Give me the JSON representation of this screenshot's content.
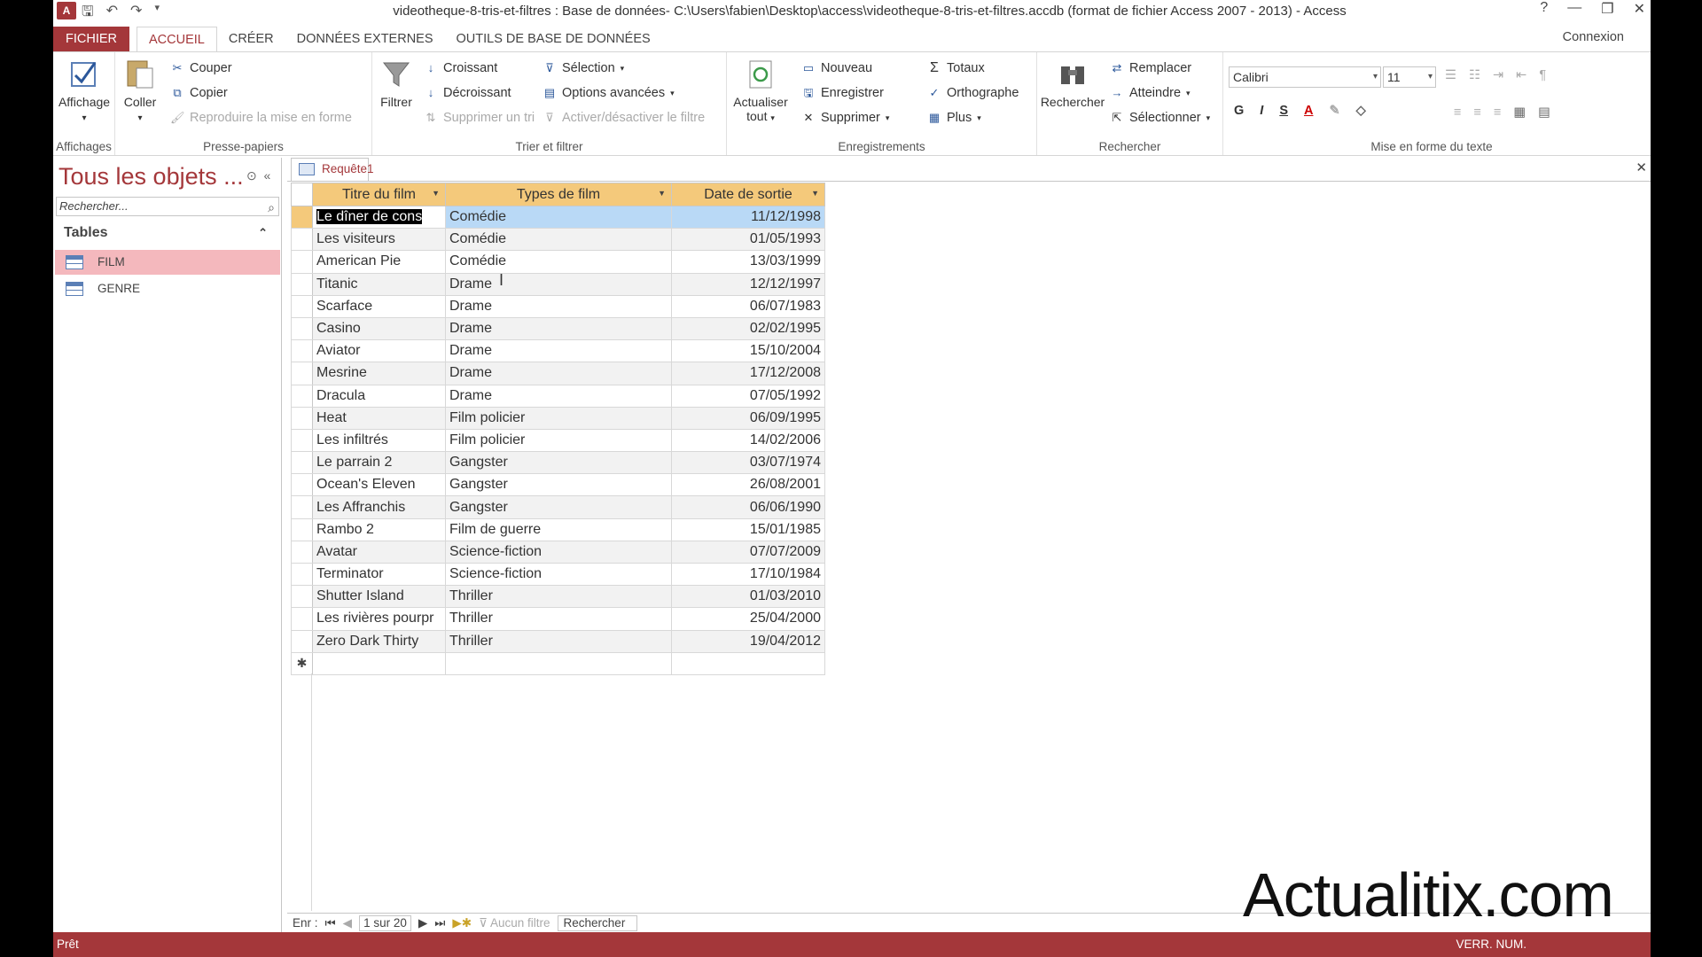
{
  "window": {
    "title": "videotheque-8-tris-et-filtres : Base de données- C:\\Users\\fabien\\Desktop\\access\\videotheque-8-tris-et-filtres.accdb (format de fichier Access 2007 - 2013) - Access",
    "help": "?",
    "minimize": "—",
    "restore": "❐",
    "close": "✕",
    "app_icon": "A"
  },
  "tabs": [
    "FICHIER",
    "ACCUEIL",
    "CRÉER",
    "DONNÉES EXTERNES",
    "OUTILS DE BASE DE DONNÉES"
  ],
  "account": "Connexion",
  "ribbon": {
    "affichages": {
      "view": "Affichage",
      "label": "Affichages"
    },
    "presse": {
      "paste": "Coller",
      "cut": "Couper",
      "copy": "Copier",
      "format_painter": "Reproduire la mise en forme",
      "label": "Presse-papiers"
    },
    "trier": {
      "filter": "Filtrer",
      "asc": "Croissant",
      "desc": "Décroissant",
      "remove_sort": "Supprimer un tri",
      "selection": "Sélection",
      "advanced": "Options avancées",
      "toggle_filter": "Activer/désactiver le filtre",
      "label": "Trier et filtrer"
    },
    "enreg": {
      "refresh": "Actualiser",
      "refresh2": "tout",
      "new": "Nouveau",
      "save": "Enregistrer",
      "delete": "Supprimer",
      "totals": "Totaux",
      "spelling": "Orthographe",
      "more": "Plus",
      "label": "Enregistrements"
    },
    "rech": {
      "find": "Rechercher",
      "replace": "Remplacer",
      "goto": "Atteindre",
      "select": "Sélectionner",
      "label": "Rechercher"
    },
    "texte": {
      "font": "Calibri",
      "size": "11",
      "bold": "G",
      "italic": "I",
      "underline": "S",
      "label": "Mise en forme du texte"
    }
  },
  "nav": {
    "title": "Tous les objets ...",
    "search_placeholder": "Rechercher...",
    "section": "Tables",
    "items": [
      "FILM",
      "GENRE"
    ]
  },
  "document": {
    "tab": "Requête1",
    "columns": [
      "Titre du film",
      "Types de film",
      "Date de sortie"
    ],
    "rows": [
      [
        "Le dîner de cons",
        "Comédie",
        "11/12/1998"
      ],
      [
        "Les visiteurs",
        "Comédie",
        "01/05/1993"
      ],
      [
        "American Pie",
        "Comédie",
        "13/03/1999"
      ],
      [
        "Titanic",
        "Drame",
        "12/12/1997"
      ],
      [
        "Scarface",
        "Drame",
        "06/07/1983"
      ],
      [
        "Casino",
        "Drame",
        "02/02/1995"
      ],
      [
        "Aviator",
        "Drame",
        "15/10/2004"
      ],
      [
        "Mesrine",
        "Drame",
        "17/12/2008"
      ],
      [
        "Dracula",
        "Drame",
        "07/05/1992"
      ],
      [
        "Heat",
        "Film policier",
        "06/09/1995"
      ],
      [
        "Les infiltrés",
        "Film policier",
        "14/02/2006"
      ],
      [
        "Le parrain 2",
        "Gangster",
        "03/07/1974"
      ],
      [
        "Ocean's Eleven",
        "Gangster",
        "26/08/2001"
      ],
      [
        "Les Affranchis",
        "Gangster",
        "06/06/1990"
      ],
      [
        "Rambo 2",
        "Film de guerre",
        "15/01/1985"
      ],
      [
        "Avatar",
        "Science-fiction",
        "07/07/2009"
      ],
      [
        "Terminator",
        "Science-fiction",
        "17/10/1984"
      ],
      [
        "Shutter Island",
        "Thriller",
        "01/03/2010"
      ],
      [
        "Les rivières pourpr",
        "Thriller",
        "25/04/2000"
      ],
      [
        "Zero Dark Thirty",
        "Thriller",
        "19/04/2012"
      ]
    ],
    "new_row_marker": "✱"
  },
  "record_nav": {
    "label": "Enr :",
    "position": "1 sur 20",
    "filter": "Aucun filtre",
    "search": "Rechercher"
  },
  "status": {
    "left": "Prêt",
    "right": "VERR. NUM."
  },
  "watermark": "Actualitix.com",
  "colors": {
    "accent": "#a4373a",
    "header": "#f4c97b",
    "selection": "#b9d9f6",
    "nav_selected": "#f4b8bd"
  }
}
